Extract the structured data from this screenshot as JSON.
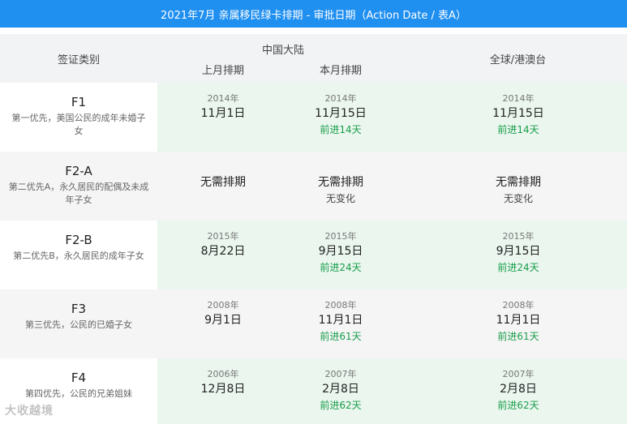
{
  "title": "2021年7月 亲属移民绿卡排期 - 审批日期（Action Date / 表A）",
  "header": {
    "category": "签证类别",
    "china": "中国大陆",
    "last_month": "上月排期",
    "this_month": "本月排期",
    "global": "全球/港澳台"
  },
  "rows": [
    {
      "code": "F1",
      "desc": "第一优先，美国公民的成年未婚子女",
      "last": {
        "year": "2014年",
        "date": "11月1日"
      },
      "this": {
        "year": "2014年",
        "date": "11月15日",
        "change": "前进14天"
      },
      "global": {
        "year": "2014年",
        "date": "11月15日",
        "change": "前进14天"
      }
    },
    {
      "code": "F2-A",
      "desc": "第二优先A，永久居民的配偶及未成年子女",
      "last": {
        "text": "无需排期"
      },
      "this": {
        "text": "无需排期",
        "change": "无变化"
      },
      "global": {
        "text": "无需排期",
        "change": "无变化"
      }
    },
    {
      "code": "F2-B",
      "desc": "第二优先B，永久居民的成年子女",
      "last": {
        "year": "2015年",
        "date": "8月22日"
      },
      "this": {
        "year": "2015年",
        "date": "9月15日",
        "change": "前进24天"
      },
      "global": {
        "year": "2015年",
        "date": "9月15日",
        "change": "前进24天"
      }
    },
    {
      "code": "F3",
      "desc": "第三优先，公民的已婚子女",
      "last": {
        "year": "2008年",
        "date": "9月1日"
      },
      "this": {
        "year": "2008年",
        "date": "11月1日",
        "change": "前进61天"
      },
      "global": {
        "year": "2008年",
        "date": "11月1日",
        "change": "前进61天"
      }
    },
    {
      "code": "F4",
      "desc": "第四优先，公民的兄弟姐妹",
      "last": {
        "year": "2006年",
        "date": "12月8日"
      },
      "this": {
        "year": "2007年",
        "date": "2月8日",
        "change": "前进62天"
      },
      "global": {
        "year": "2007年",
        "date": "2月8日",
        "change": "前进62天"
      }
    }
  ],
  "watermark": "大收越境",
  "colors": {
    "title_bg": "#1f8ff0",
    "advance": "#1a9e4b",
    "row_green": "#eaf6ee"
  }
}
